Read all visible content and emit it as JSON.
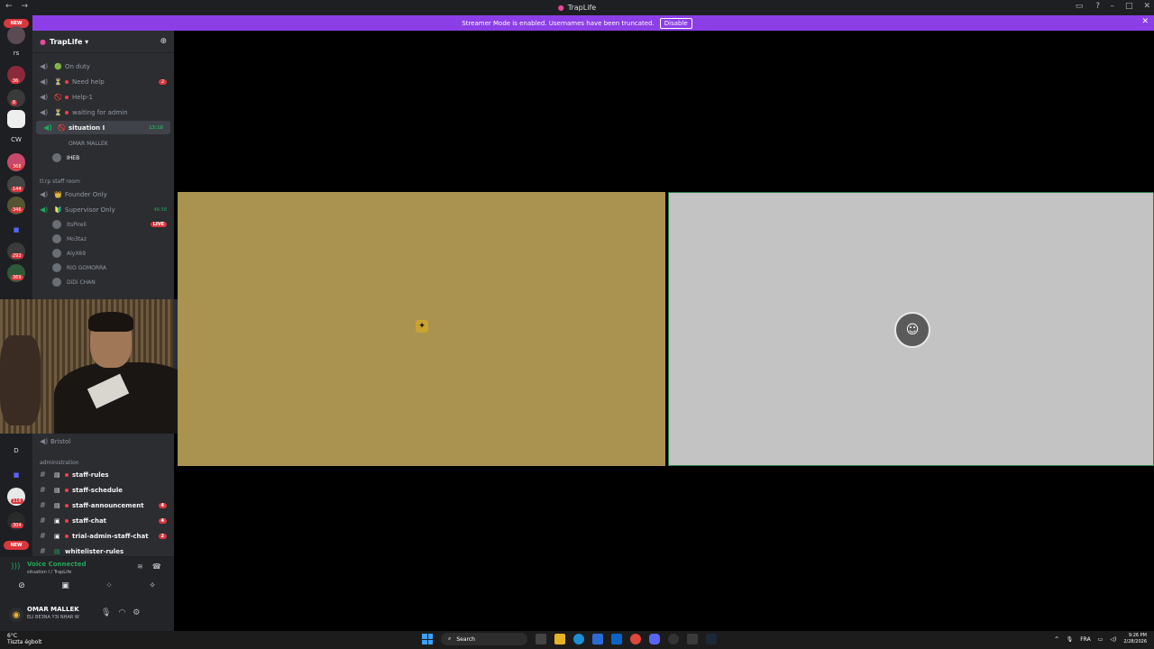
{
  "app": {
    "title": "TrapLife"
  },
  "banner": {
    "text": "Streamer Mode is enabled. Usernames have been truncated.",
    "button": "Disable"
  },
  "rail": {
    "new_top": "NEW",
    "new_bottom": "NEW",
    "labels": [
      "rs",
      "CW",
      "D"
    ],
    "badges": [
      "36",
      "8",
      "368",
      "144",
      "346",
      "292",
      "369",
      "116",
      "304"
    ]
  },
  "server": {
    "name": "TrapLife ▾"
  },
  "channels": [
    {
      "icon": "speaker",
      "emoji": "🟢",
      "name": "On duty"
    },
    {
      "icon": "speaker",
      "emoji": "⏳",
      "name": "Need help",
      "count": "2"
    },
    {
      "icon": "speaker",
      "emoji": "🚫",
      "name": "Help-1"
    },
    {
      "icon": "speaker",
      "emoji": "⏳",
      "name": "waiting for admin"
    },
    {
      "icon": "speaker",
      "emoji": "🚫",
      "name": "situation I",
      "time": "13:18"
    }
  ],
  "voice_users_1": [
    "OMAR MALLEK",
    "IHEB"
  ],
  "category1": "tl.rp staff room",
  "channels2": [
    {
      "emoji": "👑",
      "name": "Founder Only"
    },
    {
      "emoji": "🔰",
      "name": "Supervisor Only",
      "time": "46:58"
    }
  ],
  "voice_users_2": [
    {
      "name": "ItsPireli",
      "live": "LIVE"
    },
    {
      "name": "Mo3taz"
    },
    {
      "name": "AlyX69"
    },
    {
      "name": "RIO GOMORRA"
    },
    {
      "name": "DiDi CHAN"
    }
  ],
  "channel_bristol": "Bristol",
  "category2": "administration",
  "channels3": [
    {
      "name": "staff-rules"
    },
    {
      "name": "staff-schedule"
    },
    {
      "name": "staff-announcement",
      "count": "4"
    },
    {
      "name": "staff-chat",
      "count": "4"
    },
    {
      "name": "trial-admin-staff-chat",
      "count": "2"
    },
    {
      "name": "whitelister-rules"
    }
  ],
  "voice": {
    "status": "Voice Connected",
    "location": "situation I / TrapLife"
  },
  "user": {
    "name": "OMAR MALLEK",
    "status": "ELI BE3NA Y3I NHAR W"
  },
  "taskbar": {
    "weather_temp": "6°C",
    "weather_desc": "Tiszta égbolt",
    "search": "Search",
    "lang": "FRA",
    "time": "9:26 PM",
    "date": "2/28/2026"
  }
}
